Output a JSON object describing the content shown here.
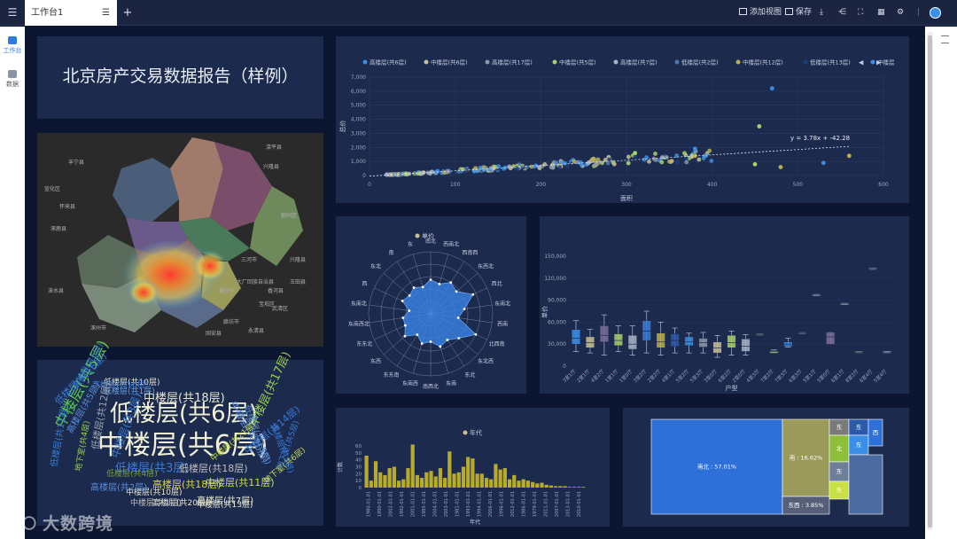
{
  "topbar": {
    "tab_label": "工作台1",
    "add_view": "添加视图",
    "save": "保存"
  },
  "sidebar": {
    "items": [
      {
        "label": "工作台",
        "icon": "workspace-icon"
      },
      {
        "label": "数据",
        "icon": "database-icon"
      }
    ]
  },
  "title_card": {
    "title": "北京房产交易数据报告（样例）"
  },
  "map": {
    "labels": [
      "滦平县",
      "宣化区",
      "怀来县",
      "涿鹿县",
      "兴隆县",
      "蓟州区",
      "兴隆县",
      "丰宁县",
      "涞水县",
      "涿州市",
      "廊坊市",
      "固安县",
      "霸州市",
      "三河市",
      "大厂回族自治县",
      "香河县",
      "玉田县",
      "宝坻区",
      "武清区",
      "永清县"
    ]
  },
  "word_cloud": {
    "words": [
      {
        "text": "中楼层(共6层)",
        "color": "#f1f1d8"
      },
      {
        "text": "低楼层(共6层)",
        "color": "#f1f1d8"
      },
      {
        "text": "中楼层(共5层)",
        "color": "#58c84e"
      },
      {
        "text": "低楼层(共3层)",
        "color": "#3a7bd5"
      },
      {
        "text": "中楼层(共18层)",
        "color": "#e7e7d0"
      },
      {
        "text": "低楼层(共18层)",
        "color": "#bfbfbf"
      },
      {
        "text": "中楼层(共17层)",
        "color": "#9ad24a"
      },
      {
        "text": "高楼层(共18层)",
        "color": "#d8d83a"
      },
      {
        "text": "中楼层(共11层)",
        "color": "#c6e04a"
      },
      {
        "text": "中楼层(共14层)",
        "color": "#3a7bd5"
      },
      {
        "text": "高楼层(共7层)",
        "color": "#e7e7d0"
      },
      {
        "text": "低楼层(共4层)",
        "color": "#7a9a3a"
      },
      {
        "text": "低楼层(共10层)",
        "color": "#e7e7d0"
      },
      {
        "text": "高楼层(共16层)",
        "color": "#3a7bd5"
      },
      {
        "text": "低楼层(共16层)",
        "color": "#3a7bd5"
      },
      {
        "text": "低楼层(共1层)",
        "color": "#6aa0e0"
      },
      {
        "text": "中楼层(共20层)",
        "color": "#5a8fd8"
      },
      {
        "text": "低楼层(共12层)",
        "color": "#9aa0b0"
      },
      {
        "text": "中楼层(共10层)",
        "color": "#e7e7d0"
      },
      {
        "text": "高楼层(共20层)",
        "color": "#e7e7d0"
      },
      {
        "text": "中楼层(共13层)",
        "color": "#e7e7d0"
      },
      {
        "text": "中楼层(共3层)",
        "color": "#3a7bd5"
      },
      {
        "text": "低楼层(共15层)",
        "color": "#5a8fd8"
      },
      {
        "text": "低楼层(共11层)",
        "color": "#3a7bd5"
      },
      {
        "text": "地下室(共6层)",
        "color": "#c6e04a"
      },
      {
        "text": "高楼层(共3层)",
        "color": "#3a7bd5"
      },
      {
        "text": "地下室(共4层)",
        "color": "#9ad24a"
      },
      {
        "text": "高楼层(共2层)",
        "color": "#5a8fd8"
      },
      {
        "text": "地下室(共5层)",
        "color": "#3a7bd5"
      },
      {
        "text": "中楼层(共1层)",
        "color": "#bfbfbf"
      },
      {
        "text": "高楼层(共5层)",
        "color": "#5a8fd8"
      },
      {
        "text": "中楼层(共21层)",
        "color": "#c6e04a"
      },
      {
        "text": "高楼层(共6层)",
        "color": "#3a7bd5"
      }
    ]
  },
  "chart_data": [
    {
      "type": "scatter",
      "legend": [
        "高楼层(共6层)",
        "中楼层(共6层)",
        "高楼层(共17层)",
        "中楼层(共5层)",
        "高楼层(共7层)",
        "低楼层(共2层)",
        "中楼层(共12层)",
        "低楼层(共13层)",
        "中楼层"
      ],
      "legend_colors": [
        "#3a8ee6",
        "#c8c090",
        "#8c95a8",
        "#a8d06a",
        "#a9b3c6",
        "#4a78b0",
        "#b8b04a",
        "#1c3c7a",
        "#3a8ee6"
      ],
      "xlabel": "面积",
      "ylabel": "总价",
      "xlim": [
        0,
        600
      ],
      "ylim": [
        0,
        7000
      ],
      "xticks": [
        "0",
        "100",
        "200",
        "300",
        "400",
        "500",
        "600"
      ],
      "yticks": [
        "0",
        "1,000",
        "2,000",
        "3,000",
        "4,000",
        "5,000",
        "6,000",
        "7,000"
      ],
      "trendline_label": "y = 3.78x + -42.28",
      "trendline": {
        "slope": 3.78,
        "intercept": -42.28
      },
      "outliers": [
        [
          470,
          6200
        ],
        [
          455,
          3500
        ],
        [
          560,
          1400
        ],
        [
          530,
          900
        ],
        [
          450,
          800
        ],
        [
          480,
          600
        ],
        [
          380,
          1900
        ],
        [
          310,
          1600
        ],
        [
          380,
          1400
        ]
      ]
    },
    {
      "type": "radar",
      "legend": [
        "单价"
      ],
      "axes": [
        "南北",
        "西南北",
        "西南西",
        "东西北",
        "西北",
        "东南北",
        "西南",
        "北西南",
        "东北西",
        "东北",
        "东南",
        "南西北",
        "东南西",
        "东东南",
        "东西",
        "东东北",
        "东南西北",
        "东南北",
        "西",
        "东北",
        "南",
        "东"
      ],
      "values": [
        0.55,
        0.5,
        0.6,
        0.55,
        0.75,
        0.55,
        0.45,
        0.8,
        0.6,
        0.5,
        0.55,
        0.45,
        0.5,
        0.4,
        0.55,
        0.45,
        0.45,
        0.35,
        0.5,
        0.45,
        0.5,
        0.45
      ]
    },
    {
      "type": "box",
      "xlabel": "户型",
      "ylabel": "单价",
      "ylim": [
        0,
        150000
      ],
      "yticks": [
        "0",
        "30,000",
        "60,000",
        "90,000",
        "120,000",
        "150,000"
      ],
      "categories": [
        "3室1厅",
        "2室1厅",
        "4室2厅",
        "1室1厅",
        "1室0厅",
        "3室2厅",
        "2室2厅",
        "4室1厅",
        "5室2厅",
        "5室3厅",
        "3室0厅",
        "6室2厅",
        "2室0厅",
        "4室3厅",
        "7室2厅",
        "7室3厅",
        "6室3厅",
        "5室1厅",
        "5室0厅",
        "6室1厅",
        "8室2厅",
        "6室4厅",
        "5室4厅"
      ],
      "boxes": [
        [
          20000,
          30000,
          38000,
          50000,
          62000
        ],
        [
          18000,
          25000,
          32000,
          40000,
          50000
        ],
        [
          15000,
          33000,
          42000,
          55000,
          70000
        ],
        [
          20000,
          28000,
          35000,
          44000,
          55000
        ],
        [
          15000,
          23000,
          30000,
          42000,
          55000
        ],
        [
          18000,
          35000,
          48000,
          62000,
          75000
        ],
        [
          15000,
          25000,
          33000,
          45000,
          60000
        ],
        [
          18000,
          27000,
          35000,
          44000,
          52000
        ],
        [
          18000,
          28000,
          33000,
          40000,
          45000
        ],
        [
          18000,
          26000,
          32000,
          38000,
          46000
        ],
        [
          12000,
          18000,
          25000,
          33000,
          42000
        ],
        [
          15000,
          25000,
          32000,
          42000,
          48000
        ],
        [
          15000,
          20000,
          27000,
          37000,
          43000
        ],
        [
          42000,
          42000,
          43000,
          44000,
          44000
        ],
        [
          18000,
          18000,
          20000,
          21000,
          22000
        ],
        [
          26000,
          27000,
          30000,
          33000,
          38000
        ],
        [
          44000,
          44000,
          45000,
          46000,
          46000
        ],
        [
          96000,
          96000,
          97000,
          98000,
          98000
        ],
        [
          30000,
          30000,
          40000,
          46000,
          46000
        ],
        [
          84000,
          84000,
          85000,
          86000,
          86000
        ],
        [
          18000,
          18000,
          19000,
          20000,
          20000
        ],
        [
          132000,
          132000,
          133000,
          134000,
          134000
        ],
        [
          18000,
          18000,
          19000,
          20000,
          20000
        ]
      ]
    },
    {
      "type": "bar",
      "legend": [
        "年代"
      ],
      "xlabel": "年代",
      "ylabel": "计数",
      "ylim": [
        0,
        60
      ],
      "yticks": [
        "0",
        "10",
        "20",
        "30",
        "40",
        "50",
        "60"
      ],
      "xticks": [
        "1980-01-01",
        "1990-01-01",
        "2002-01-01",
        "1992-01-01",
        "2001-01-01",
        "1985-01-01",
        "2004-01-01",
        "2003-01-01",
        "1981-01-01",
        "1993-01-01",
        "1994-01-01",
        "2006-01-01",
        "1996-01-01",
        "2012-01-01",
        "1986-01-01",
        "1979-01-01",
        "2011-01-01",
        "2007-01-01",
        "2013-01-01",
        "2010-01-01"
      ],
      "values": [
        46,
        10,
        38,
        22,
        18,
        28,
        30,
        10,
        12,
        28,
        62,
        18,
        14,
        22,
        24,
        16,
        28,
        14,
        52,
        20,
        22,
        30,
        44,
        42,
        20,
        20,
        14,
        12,
        34,
        26,
        28,
        12,
        18,
        10,
        12,
        10,
        8,
        6,
        7,
        4,
        3,
        2,
        2,
        2,
        1,
        1,
        1,
        1
      ]
    },
    {
      "type": "treemap",
      "items": [
        {
          "label": "南北 : 57.01%",
          "value": 57.01,
          "color": "#2e6fd8"
        },
        {
          "label": "南 : 16.62%",
          "value": 16.62,
          "color": "#9a9a5a"
        },
        {
          "label": "东西 : 3.85%",
          "value": 3.85,
          "color": "#556078"
        },
        {
          "label": "东",
          "value": 3.2,
          "color": "#7a7a7a"
        },
        {
          "label": "东",
          "value": 2.5,
          "color": "#2b5aa8"
        },
        {
          "label": "北",
          "value": 2.4,
          "color": "#8fbf3a"
        },
        {
          "label": "东",
          "value": 2.1,
          "color": "#3a8ee6"
        },
        {
          "label": "西",
          "value": 1.8,
          "color": "#2e6fd8"
        },
        {
          "label": "东",
          "value": 1.6,
          "color": "#6e7f9a"
        },
        {
          "label": "东",
          "value": 1.4,
          "color": "#c8e044"
        },
        {
          "label": "",
          "value": 5.0,
          "color": "#4a6aa0"
        }
      ]
    }
  ]
}
